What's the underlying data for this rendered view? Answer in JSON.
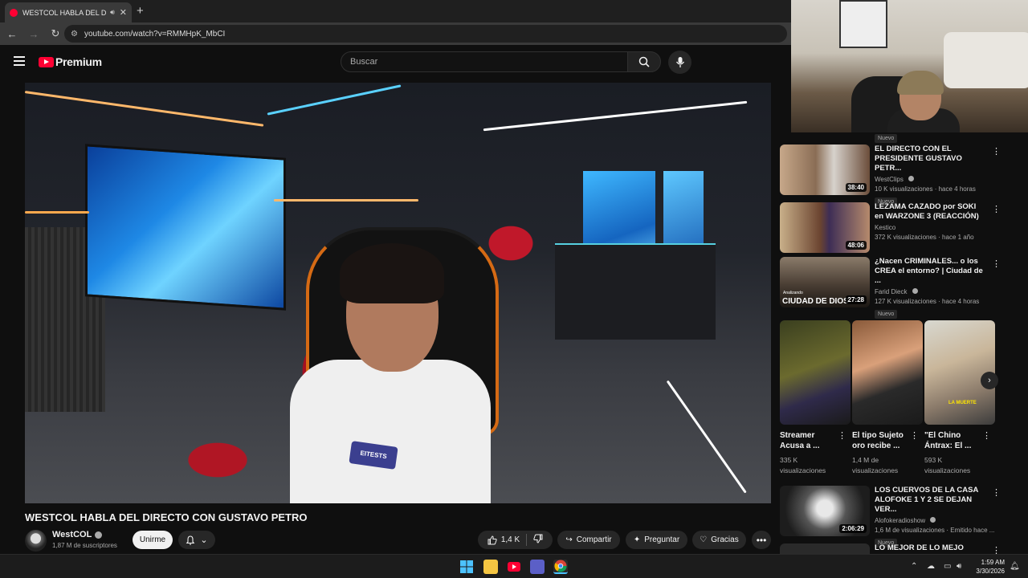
{
  "browser": {
    "tab_title": "WESTCOL HABLA DEL DIRE",
    "tab_audio_icon": "speaker-icon",
    "url": "youtube.com/watch?v=RMMHpK_MbCI"
  },
  "header": {
    "logo_text": "Premium",
    "search_placeholder": "Buscar"
  },
  "video": {
    "title": "WESTCOL HABLA DEL DIRECTO CON GUSTAVO PETRO",
    "channel": "WestCOL",
    "subscribers": "1,87 M de suscriptores",
    "join_label": "Unirme",
    "likes": "1,4 K",
    "share_label": "Compartir",
    "ask_label": "Preguntar",
    "thanks_label": "Gracias",
    "shirt_text": "EITESTS"
  },
  "sidebar": {
    "new_badge": "Nuevo",
    "recommendations": [
      {
        "title": "EL DIRECTO CON EL PRESIDENTE GUSTAVO PETR...",
        "channel": "WestClips",
        "verified": true,
        "stats": "10 K visualizaciones · hace 4 horas",
        "duration": "38:40",
        "badge": "Nuevo"
      },
      {
        "title": "LEZAMA CAZADO por SOKI en WARZONE 3 (REACCIÓN)",
        "channel": "Kestico",
        "verified": false,
        "stats": "372 K visualizaciones · hace 1 año",
        "duration": "48:06",
        "badge": ""
      },
      {
        "title": "¿Nacen CRIMINALES... o los CREA el entorno? | Ciudad de ...",
        "channel": "Farid Dieck",
        "verified": true,
        "stats": "127 K visualizaciones · hace 4 horas",
        "duration": "27:28",
        "badge": "Nuevo",
        "thumb_caption": "CIUDAD DE DIOS",
        "thumb_small": "Analizando"
      },
      {
        "title": "LOS CUERVOS DE LA CASA ALOFOKE 1 Y 2 SE DEJAN VER...",
        "channel": "Alofokeradioshow",
        "verified": true,
        "stats": "1,6 M de visualizaciones · Emitido hace ...",
        "duration": "2:06:29",
        "badge": "Nuevo"
      },
      {
        "title": "LO MEJOR DE LO MEJO",
        "channel": "",
        "verified": false,
        "stats": "",
        "duration": "",
        "badge": ""
      }
    ],
    "shorts": [
      {
        "title": "Streamer Acusa a ...",
        "views": "335 K visualizaciones"
      },
      {
        "title": "El tipo Sujeto oro recibe ...",
        "views": "1,4 M de visualizaciones"
      },
      {
        "title": "\"El Chino Ántrax: El ...",
        "views": "593 K visualizaciones",
        "overlay": "LA MUERTE"
      }
    ]
  },
  "taskbar": {
    "time": "1:59 AM",
    "date": "3/30/2026"
  }
}
